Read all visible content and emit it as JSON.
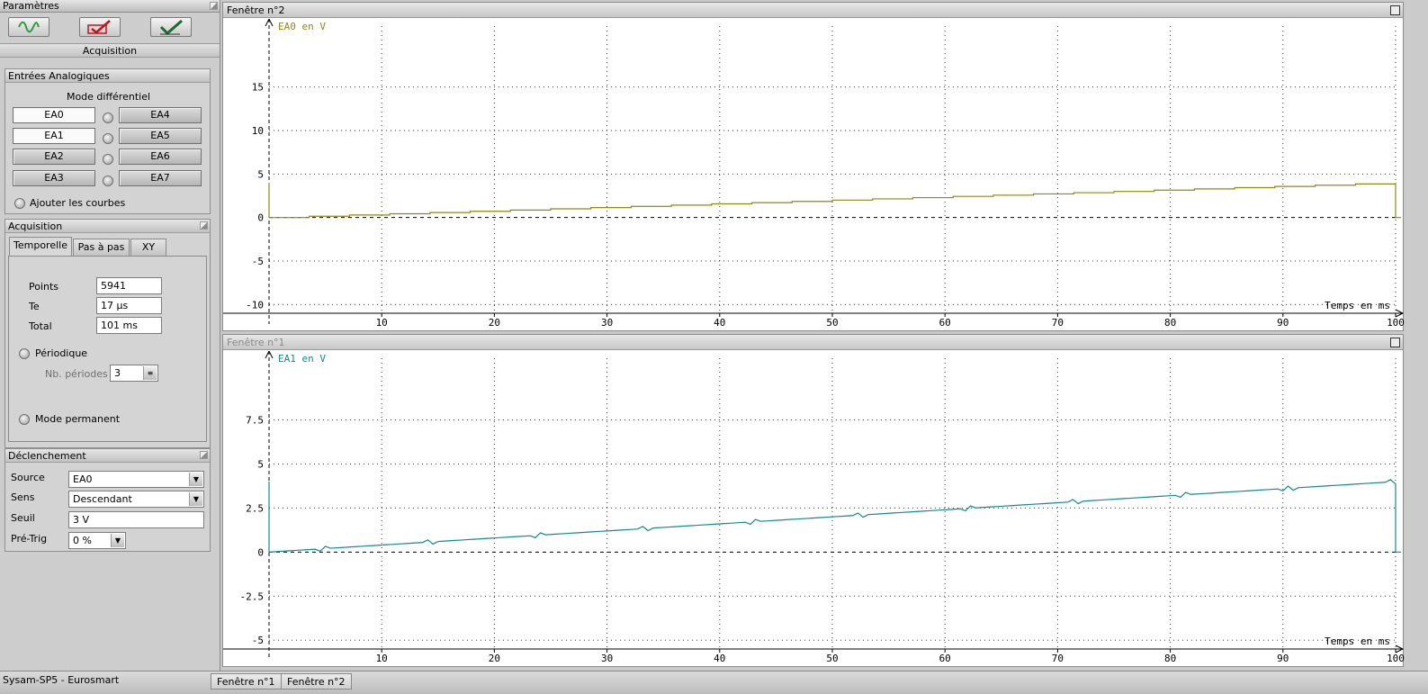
{
  "left_panel": {
    "header": "Paramètres",
    "toolbar": [
      {
        "name": "waveform-icon",
        "color": "#2e9a3c"
      },
      {
        "name": "check-cross-icon",
        "color": "#c2141c"
      },
      {
        "name": "checkmark-icon",
        "color": "#1d6a2f"
      }
    ],
    "section_title": "Acquisition",
    "analog": {
      "title": "Entrées Analogiques",
      "mode": "Mode différentiel",
      "left_channels": [
        "EA0",
        "EA1",
        "EA2",
        "EA3"
      ],
      "right_channels": [
        "EA4",
        "EA5",
        "EA6",
        "EA7"
      ],
      "add_curves": "Ajouter les courbes"
    },
    "acquisition": {
      "title": "Acquisition",
      "tabs": [
        "Temporelle",
        "Pas à pas",
        "XY"
      ],
      "points_label": "Points",
      "points_value": "5941",
      "te_label": "Te",
      "te_value": "17 µs",
      "total_label": "Total",
      "total_value": "101 ms",
      "periodic_label": "Périodique",
      "periods_label": "Nb. périodes",
      "periods_value": "3",
      "permanent_label": "Mode permanent"
    },
    "trigger": {
      "title": "Déclenchement",
      "source_label": "Source",
      "source_value": "EA0",
      "sens_label": "Sens",
      "sens_value": "Descendant",
      "seuil_label": "Seuil",
      "seuil_value": "3 V",
      "pretrig_label": "Pré-Trig",
      "pretrig_value": "0 %"
    }
  },
  "windows": [
    {
      "title": "Fenêtre n°2",
      "series_label": "EA0 en V",
      "color": "#8c8a12",
      "x_label": "Temps en ms"
    },
    {
      "title": "Fenêtre n°1",
      "series_label": "EA1 en V",
      "color": "#138a8c",
      "x_label": "Temps en ms"
    }
  ],
  "chart_data": [
    {
      "type": "line",
      "series": [
        {
          "name": "EA0 en V",
          "x": [
            0,
            100
          ],
          "y": [
            0,
            4
          ]
        }
      ],
      "xlabel": "Temps en ms",
      "ylabel": "EA0 en V",
      "xlim": [
        0,
        100
      ],
      "ylim": [
        -11,
        22
      ],
      "x_ticks": [
        10,
        20,
        30,
        40,
        50,
        60,
        70,
        80,
        90,
        100
      ],
      "y_ticks": [
        -10,
        -5,
        0,
        5,
        10,
        15
      ],
      "y_tick_labels": [
        "-10",
        "-5",
        "0",
        "5",
        "10",
        "15"
      ],
      "grid": true
    },
    {
      "type": "line",
      "series": [
        {
          "name": "EA1 en V",
          "x": [
            0,
            100
          ],
          "y": [
            0,
            4
          ]
        }
      ],
      "xlabel": "Temps en ms",
      "ylabel": "EA1 en V",
      "xlim": [
        0,
        100
      ],
      "ylim": [
        -5.5,
        11
      ],
      "x_ticks": [
        10,
        20,
        30,
        40,
        50,
        60,
        70,
        80,
        90,
        100
      ],
      "y_ticks": [
        -5,
        -2.5,
        0,
        2.5,
        5,
        7.5
      ],
      "y_tick_labels": [
        "-5",
        "-2.5",
        "0",
        "2.5",
        "5",
        "7.5"
      ],
      "grid": true
    }
  ],
  "status": {
    "app_name": "Sysam-SP5 - Eurosmart",
    "tabs": [
      "Fenêtre n°1",
      "Fenêtre n°2"
    ]
  }
}
